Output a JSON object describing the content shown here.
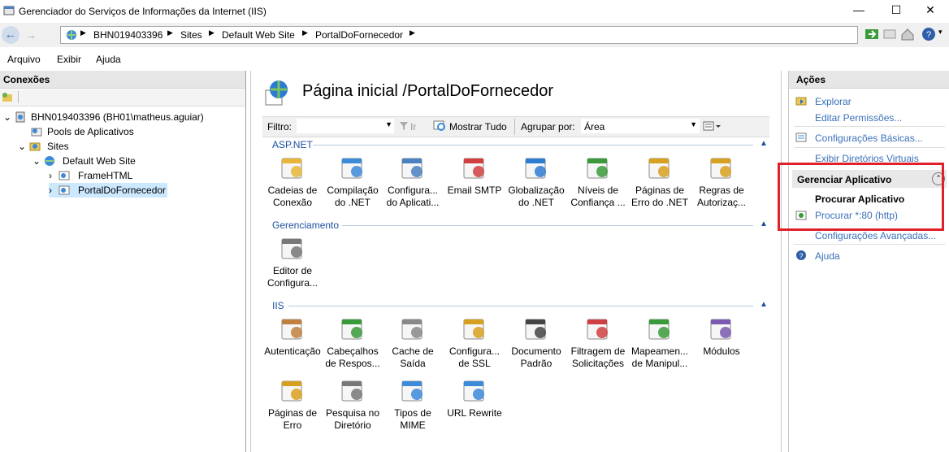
{
  "window": {
    "title": "Gerenciador do Serviços de Informações da Internet (IIS)",
    "minimize": "—",
    "maximize": "☐",
    "close": "✕"
  },
  "address": {
    "crumbs": [
      "BHN019403396",
      "Sites",
      "Default Web Site",
      "PortalDoFornecedor"
    ]
  },
  "menu": [
    "Arquivo",
    "Exibir",
    "Ajuda"
  ],
  "connections": {
    "header": "Conexões",
    "tree": [
      {
        "label": "BHN019403396 (BH01\\matheus.aguiar)",
        "expander": "⌄"
      },
      {
        "label": "Pools de Aplicativos",
        "expander": ""
      },
      {
        "label": "Sites",
        "expander": "⌄"
      },
      {
        "label": "Default Web Site",
        "expander": "⌄"
      },
      {
        "label": "FrameHTML",
        "expander": "›"
      },
      {
        "label": "PortalDoFornecedor",
        "expander": "›"
      }
    ]
  },
  "center": {
    "title": "Página inicial /PortalDoFornecedor",
    "filter_label": "Filtro:",
    "go_label": "Ir",
    "show_all_label": "Mostrar Tudo",
    "group_by_label": "Agrupar por:",
    "group_by_value": "Área",
    "groups": [
      {
        "title": "ASP.NET",
        "features": [
          {
            "line1": "Cadeias de",
            "line2": "Conexão",
            "icon": "database-icon"
          },
          {
            "line1": "Compilação",
            "line2": "do .NET",
            "icon": "download-stack-icon"
          },
          {
            "line1": "Configura...",
            "line2": "do Aplicati...",
            "icon": "checklist-icon"
          },
          {
            "line1": "Email SMTP",
            "line2": "",
            "icon": "email-icon"
          },
          {
            "line1": "Globalização",
            "line2": "do .NET",
            "icon": "globe-icon"
          },
          {
            "line1": "Níveis de",
            "line2": "Confiança ...",
            "icon": "trust-globe-icon"
          },
          {
            "line1": "Páginas de",
            "line2": "Erro do .NET",
            "icon": "error-404-icon"
          },
          {
            "line1": "Regras de",
            "line2": "Autorizaç...",
            "icon": "authorization-lock-icon"
          }
        ]
      },
      {
        "title": "Gerenciamento",
        "features": [
          {
            "line1": "Editor de",
            "line2": "Configura...",
            "icon": "config-editor-icon"
          }
        ]
      },
      {
        "title": "IIS",
        "features": [
          {
            "line1": "Autenticação",
            "line2": "",
            "icon": "authentication-user-icon"
          },
          {
            "line1": "Cabeçalhos",
            "line2": "de Respos...",
            "icon": "response-headers-icon"
          },
          {
            "line1": "Cache de",
            "line2": "Saída",
            "icon": "output-cache-icon"
          },
          {
            "line1": "Configura...",
            "line2": "de SSL",
            "icon": "ssl-lock-icon"
          },
          {
            "line1": "Documento",
            "line2": "Padrão",
            "icon": "default-document-icon"
          },
          {
            "line1": "Filtragem de",
            "line2": "Solicitações",
            "icon": "request-filter-icon"
          },
          {
            "line1": "Mapeamen...",
            "line2": "de Manipul...",
            "icon": "handler-mapping-icon"
          },
          {
            "line1": "Módulos",
            "line2": "",
            "icon": "modules-icon"
          },
          {
            "line1": "Páginas de",
            "line2": "Erro",
            "icon": "error-pages-icon"
          },
          {
            "line1": "Pesquisa no",
            "line2": "Diretório",
            "icon": "directory-browse-icon"
          },
          {
            "line1": "Tipos de",
            "line2": "MIME",
            "icon": "mime-types-icon"
          },
          {
            "line1": "URL Rewrite",
            "line2": "",
            "icon": "url-rewrite-icon"
          }
        ]
      }
    ]
  },
  "actions": {
    "header": "Ações",
    "items": [
      {
        "label": "Explorar",
        "icon": "explore-icon"
      },
      {
        "label": "Editar Permissões...",
        "icon": ""
      },
      {
        "label": "Configurações Básicas...",
        "icon": "basic-settings-icon"
      },
      {
        "label": "Exibir Diretórios Virtuais",
        "icon": ""
      }
    ],
    "manage_header": "Gerenciar Aplicativo",
    "browse_header": "Procurar Aplicativo",
    "browse_link": "Procurar *:80 (http)",
    "advanced": "Configurações Avançadas...",
    "help": "Ajuda"
  },
  "colors": {
    "link": "#3a70b9",
    "highlight": "#e0202a",
    "group": "#1e50a0"
  }
}
